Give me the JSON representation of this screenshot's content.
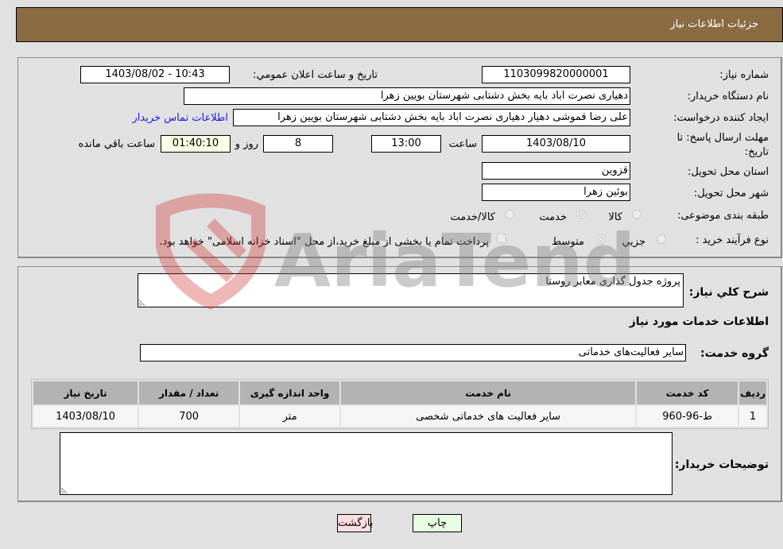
{
  "header": {
    "title": "جزئیات اطلاعات نیاز"
  },
  "form": {
    "need_number": {
      "label": "شماره نیاز:",
      "value": "1103099820000001"
    },
    "announce": {
      "label": "تاریخ و ساعت اعلان عمومي:",
      "value": "1403/08/02 - 10:43"
    },
    "buyer_org": {
      "label": "نام دستگاه خریدار:",
      "value": "دهیاری نصرت اباد بایه بخش دشتابی شهرستان بویین زهرا"
    },
    "requester": {
      "label": "ایجاد کننده درخواست:",
      "value": "علی رضا قموشی دهیار دهیاری نصرت اباد بایه بخش دشتابی شهرستان بویین زهرا"
    },
    "contact_link": "اطلاعات تماس خریدار",
    "deadline": {
      "label": "مهلت ارسال پاسخ: تا تاریخ:",
      "date": "1403/08/10",
      "time_label": "ساعت",
      "time": "13:00",
      "days": "8",
      "days_label": "روز و",
      "remaining": "01:40:10",
      "remaining_label": "ساعت باقي مانده"
    },
    "province": {
      "label": "استان محل تحویل:",
      "value": "قزوین"
    },
    "city": {
      "label": "شهر محل تحویل:",
      "value": "بوئین زهرا"
    },
    "category": {
      "label": "طبقه بندی موضوعی:",
      "options": [
        "کالا",
        "خدمت",
        "کالا/خدمت"
      ],
      "selected": "خدمت"
    },
    "purchase_type": {
      "label": "نوع فرآیند خرید :",
      "options": [
        "جزيي",
        "متوسط"
      ],
      "selected": "متوسط",
      "treasury_note": "پرداخت تمام یا بخشی از مبلغ خرید،از محل \"اسناد خزانه اسلامی\" خواهد بود."
    }
  },
  "details": {
    "description_label": "شرح کلي نياز:",
    "description": "پروژه جدول گذاری معابر روستا",
    "services_heading": "اطلاعات خدمات مورد نياز",
    "service_group_label": "گروه خدمت:",
    "service_group": "سایر فعالیت‌های خدماتی",
    "table": {
      "headers": [
        "ردیف",
        "کد خدمت",
        "نام خدمت",
        "واحد اندازه گیری",
        "تعداد / مقدار",
        "تاریخ نیاز"
      ],
      "rows": [
        [
          "1",
          "ط-96-960",
          "سایر فعالیت های خدماتی شخصی",
          "متر",
          "700",
          "1403/08/10"
        ]
      ]
    },
    "buyer_notes_label": "توضیحات خریدار:",
    "buyer_notes": ""
  },
  "buttons": {
    "print": "چاپ",
    "back": "بازگشت"
  },
  "watermark": "AriaTender.neT"
}
